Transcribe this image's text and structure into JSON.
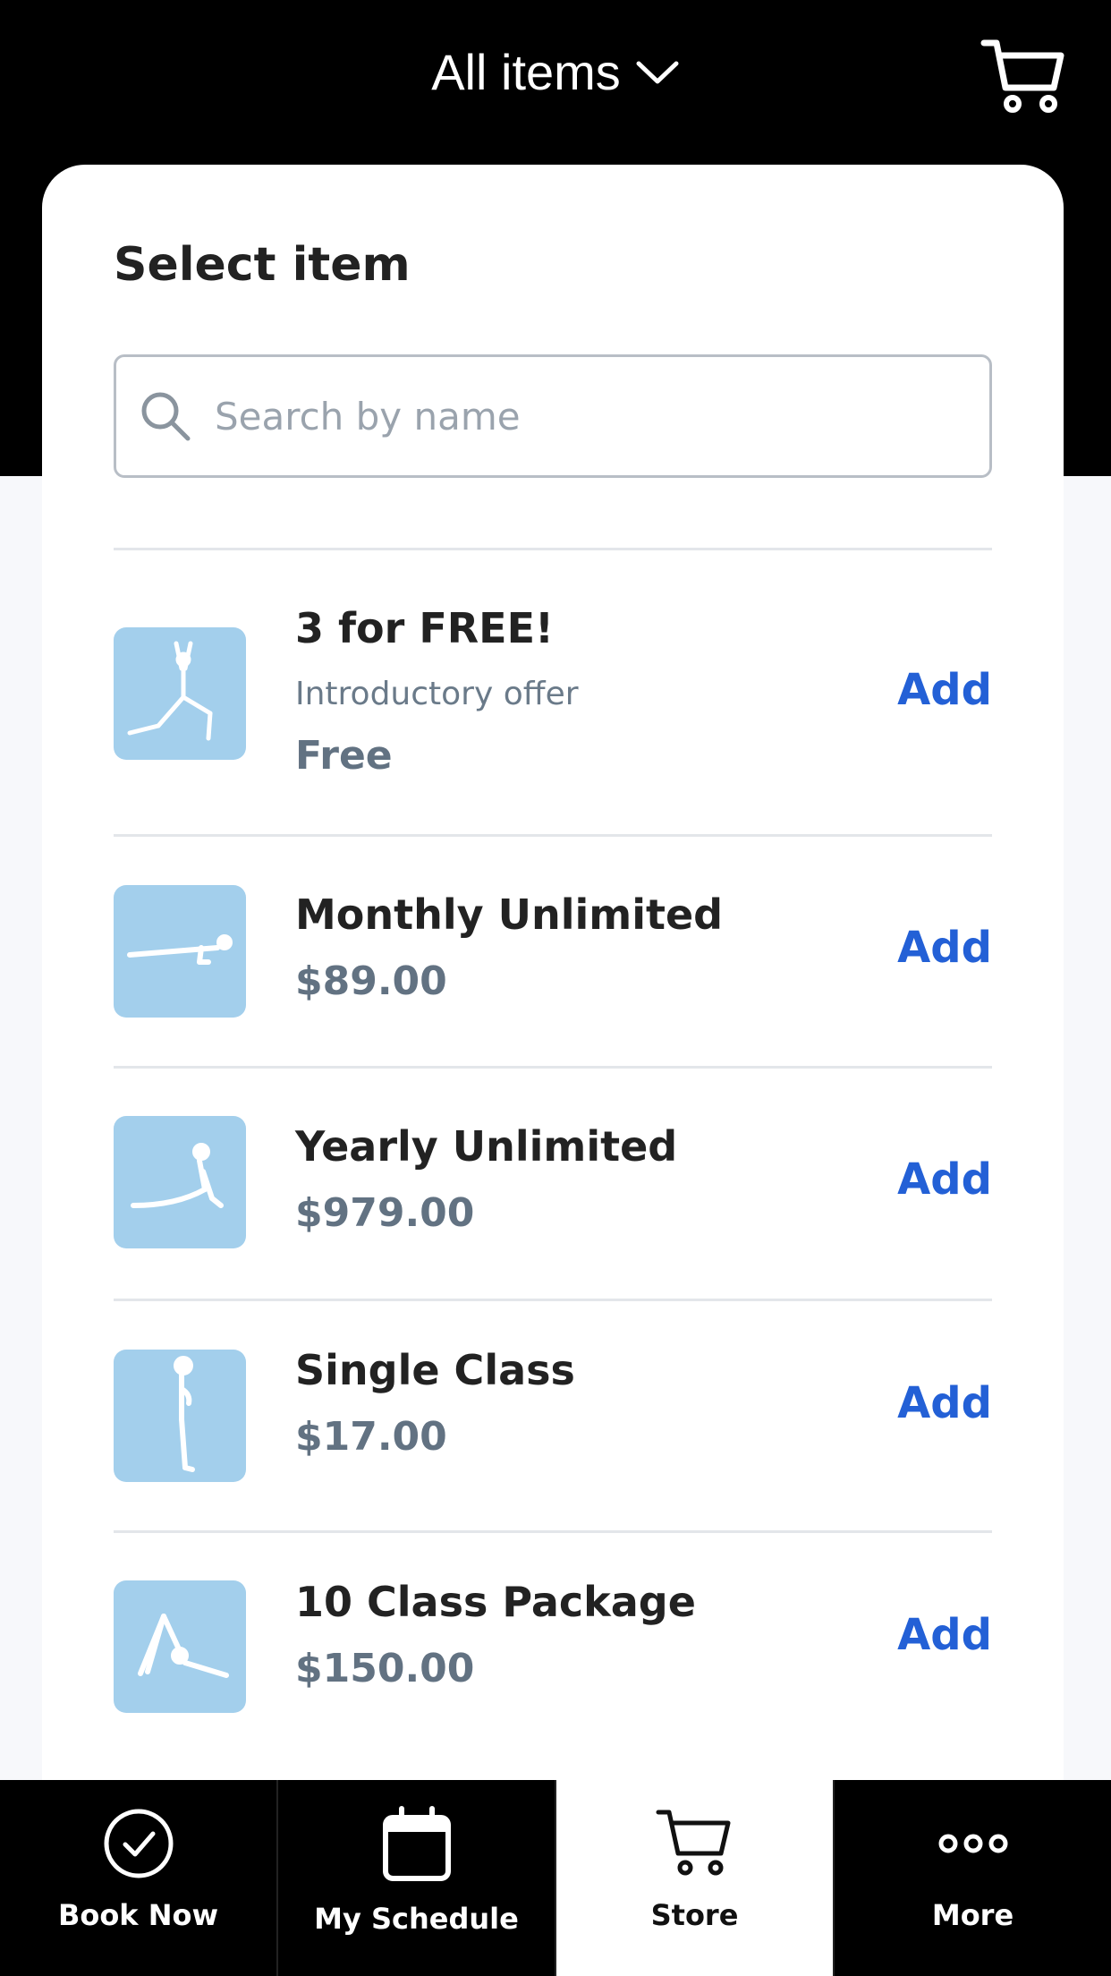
{
  "header": {
    "title": "All items",
    "dropdown_icon": "chevron-down-icon",
    "cart_icon": "cart-icon"
  },
  "card": {
    "title": "Select item",
    "search": {
      "placeholder": "Search by name",
      "value": ""
    }
  },
  "items": [
    {
      "name": "3 for FREE!",
      "subtitle": "Introductory offer",
      "price": "Free",
      "action": "Add",
      "image": "yoga-lunge-arms-up"
    },
    {
      "name": "Monthly Unlimited",
      "price": "$89.00",
      "action": "Add",
      "image": "yoga-plank"
    },
    {
      "name": "Yearly Unlimited",
      "price": "$979.00",
      "action": "Add",
      "image": "yoga-cobra"
    },
    {
      "name": "Single Class",
      "price": "$17.00",
      "action": "Add",
      "image": "yoga-standing"
    },
    {
      "name": "10 Class Package",
      "price": "$150.00",
      "action": "Add",
      "image": "yoga-downward-dog"
    }
  ],
  "tabs": [
    {
      "label": "Book Now",
      "icon": "check-circle-icon",
      "active": false
    },
    {
      "label": "My Schedule",
      "icon": "calendar-icon",
      "active": false
    },
    {
      "label": "Store",
      "icon": "cart-icon",
      "active": true
    },
    {
      "label": "More",
      "icon": "more-dots-icon",
      "active": false
    }
  ],
  "colors": {
    "header_bg": "#000000",
    "accent": "#2360d6",
    "thumb_bg": "#a3cfec",
    "price": "#627282"
  }
}
